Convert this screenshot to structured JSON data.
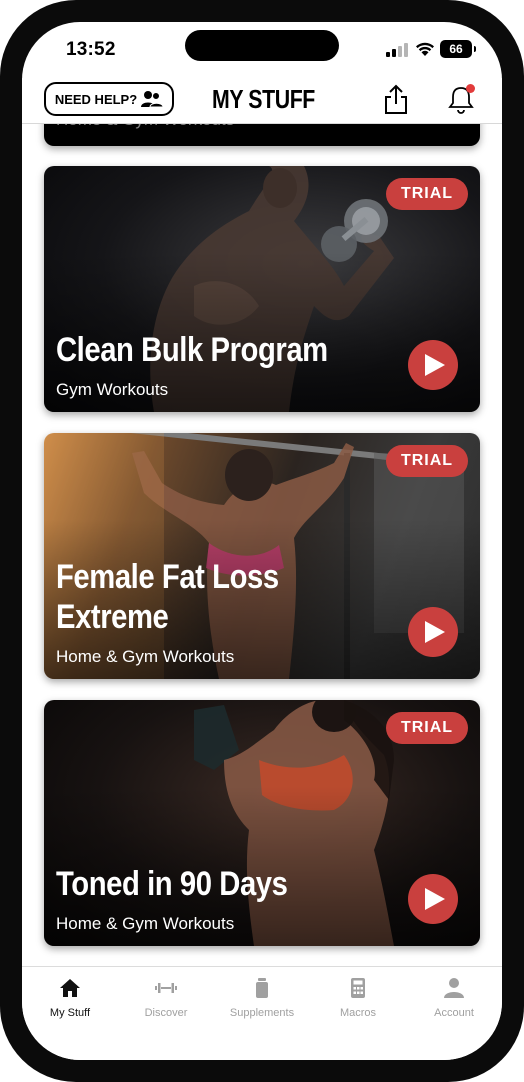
{
  "status_bar": {
    "time": "13:52",
    "battery": "66"
  },
  "header": {
    "help_label": "NEED HELP?",
    "title": "MY STUFF"
  },
  "cards": [
    {
      "subtitle": "Home & Gym Workouts"
    },
    {
      "badge": "TRIAL",
      "title": "Clean Bulk Program",
      "subtitle": "Gym Workouts"
    },
    {
      "badge": "TRIAL",
      "title": "Female Fat Loss Extreme",
      "subtitle": "Home & Gym Workouts"
    },
    {
      "badge": "TRIAL",
      "title": "Toned in 90 Days",
      "subtitle": "Home & Gym Workouts"
    }
  ],
  "tabs": [
    {
      "label": "My Stuff",
      "icon": "home-icon",
      "active": true
    },
    {
      "label": "Discover",
      "icon": "dumbbell-icon"
    },
    {
      "label": "Supplements",
      "icon": "bottle-icon"
    },
    {
      "label": "Macros",
      "icon": "calculator-icon"
    },
    {
      "label": "Account",
      "icon": "person-icon"
    }
  ],
  "colors": {
    "accent": "#c9403e",
    "notification_dot": "#e23b3b",
    "tab_inactive": "#a0a0a0"
  }
}
